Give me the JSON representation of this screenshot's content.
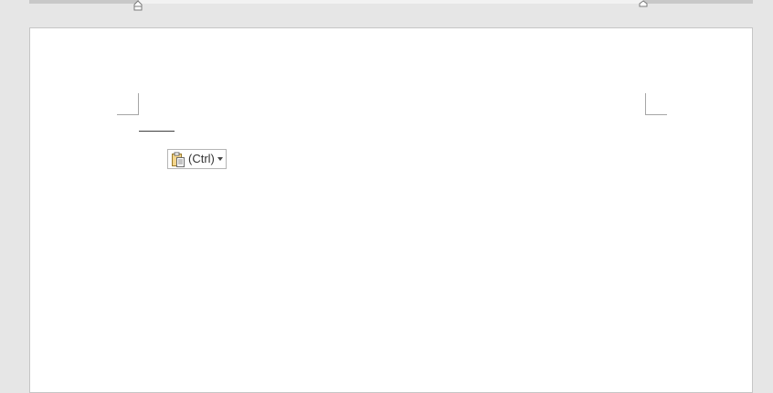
{
  "document": {
    "text_line": "———"
  },
  "paste_options": {
    "label": "(Ctrl)",
    "icon": "clipboard-paste-icon",
    "dropdown_icon": "dropdown-arrow-icon"
  },
  "colors": {
    "workspace_bg": "#e6e6e6",
    "page_bg": "#ffffff",
    "icon_accent": "#e8b84a"
  }
}
